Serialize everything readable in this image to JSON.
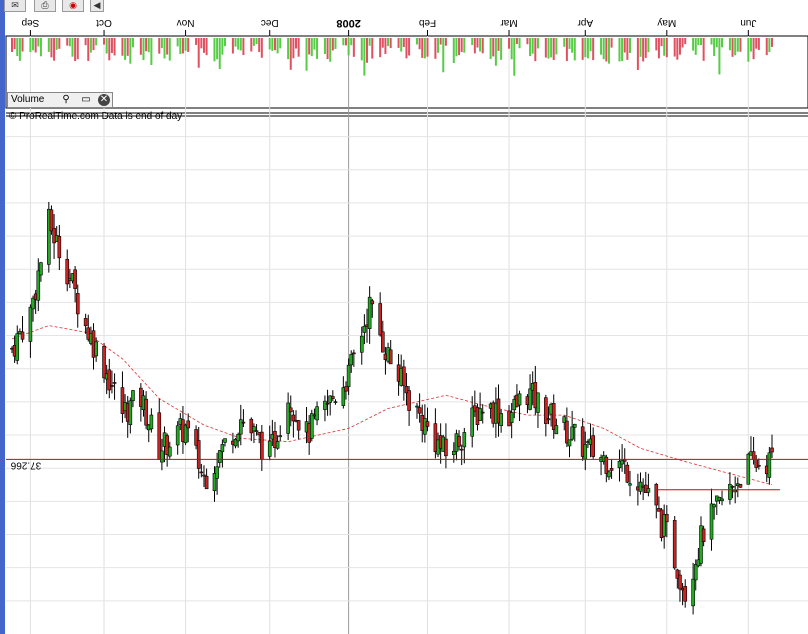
{
  "watermark": "© ProRealTime.com  Data is end of day",
  "volume_panel": {
    "label": "Volume"
  },
  "chart_data": {
    "type": "candlestick",
    "x_axis": {
      "type": "date",
      "range": [
        "2007-08-27",
        "2008-06-11"
      ],
      "tick_labels": [
        "Sep",
        "Oct",
        "Nov",
        "Dec",
        "2008",
        "Feb",
        "Mar",
        "Apr",
        "May",
        "Jun"
      ],
      "tick_dates": [
        "2007-09-03",
        "2007-10-01",
        "2007-11-01",
        "2007-12-03",
        "2008-01-02",
        "2008-02-01",
        "2008-03-03",
        "2008-04-01",
        "2008-05-02",
        "2008-06-02"
      ]
    },
    "y_axis": {
      "range": [
        32.0,
        47.5
      ],
      "tick_labels": []
    },
    "reference_lines": [
      {
        "label": "37.266",
        "value": 37.266,
        "color": "#dd0000"
      },
      {
        "label": "",
        "value": 36.35,
        "color": "#dd0000",
        "start": "2008-04-28",
        "end": "2008-06-14"
      }
    ],
    "colors": {
      "up": "#22aa22",
      "down": "#cc2222",
      "ma": "#dd3333",
      "vol_up": "#55cc44",
      "vol_down": "#e05060"
    },
    "close_series": [
      {
        "date": "2007-08-27",
        "close": 40.6
      },
      {
        "date": "2007-09-03",
        "close": 41.7
      },
      {
        "date": "2007-09-10",
        "close": 44.4
      },
      {
        "date": "2007-09-17",
        "close": 43.0
      },
      {
        "date": "2007-09-24",
        "close": 41.3
      },
      {
        "date": "2007-10-01",
        "close": 40.1
      },
      {
        "date": "2007-10-08",
        "close": 38.7
      },
      {
        "date": "2007-10-15",
        "close": 39.1
      },
      {
        "date": "2007-10-22",
        "close": 37.6
      },
      {
        "date": "2007-11-01",
        "close": 38.2
      },
      {
        "date": "2007-11-08",
        "close": 36.7
      },
      {
        "date": "2007-11-15",
        "close": 37.6
      },
      {
        "date": "2007-11-22",
        "close": 38.5
      },
      {
        "date": "2007-12-03",
        "close": 37.4
      },
      {
        "date": "2007-12-10",
        "close": 39.2
      },
      {
        "date": "2007-12-17",
        "close": 38.0
      },
      {
        "date": "2008-01-02",
        "close": 39.8
      },
      {
        "date": "2008-01-10",
        "close": 41.9
      },
      {
        "date": "2008-01-17",
        "close": 40.4
      },
      {
        "date": "2008-01-25",
        "close": 39.1
      },
      {
        "date": "2008-02-01",
        "close": 38.2
      },
      {
        "date": "2008-02-08",
        "close": 37.4
      },
      {
        "date": "2008-02-15",
        "close": 38.1
      },
      {
        "date": "2008-02-22",
        "close": 38.9
      },
      {
        "date": "2008-03-03",
        "close": 38.6
      },
      {
        "date": "2008-03-10",
        "close": 39.3
      },
      {
        "date": "2008-03-17",
        "close": 38.7
      },
      {
        "date": "2008-04-01",
        "close": 37.6
      },
      {
        "date": "2008-04-08",
        "close": 37.3
      },
      {
        "date": "2008-04-15",
        "close": 37.1
      },
      {
        "date": "2008-04-22",
        "close": 36.6
      },
      {
        "date": "2008-05-02",
        "close": 35.0
      },
      {
        "date": "2008-05-09",
        "close": 33.3
      },
      {
        "date": "2008-05-16",
        "close": 35.1
      },
      {
        "date": "2008-05-23",
        "close": 36.0
      },
      {
        "date": "2008-06-02",
        "close": 37.1
      },
      {
        "date": "2008-06-11",
        "close": 37.2
      }
    ],
    "moving_average": [
      {
        "date": "2007-08-27",
        "value": 40.9
      },
      {
        "date": "2007-09-10",
        "value": 41.3
      },
      {
        "date": "2007-09-24",
        "value": 41.1
      },
      {
        "date": "2007-10-08",
        "value": 40.3
      },
      {
        "date": "2007-10-22",
        "value": 39.1
      },
      {
        "date": "2007-11-08",
        "value": 38.3
      },
      {
        "date": "2007-11-22",
        "value": 37.9
      },
      {
        "date": "2007-12-10",
        "value": 37.8
      },
      {
        "date": "2008-01-02",
        "value": 38.2
      },
      {
        "date": "2008-01-17",
        "value": 38.8
      },
      {
        "date": "2008-02-08",
        "value": 39.2
      },
      {
        "date": "2008-02-22",
        "value": 38.9
      },
      {
        "date": "2008-03-10",
        "value": 38.6
      },
      {
        "date": "2008-03-24",
        "value": 38.6
      },
      {
        "date": "2008-04-08",
        "value": 38.2
      },
      {
        "date": "2008-04-22",
        "value": 37.6
      },
      {
        "date": "2008-05-09",
        "value": 37.2
      },
      {
        "date": "2008-05-23",
        "value": 36.9
      },
      {
        "date": "2008-06-11",
        "value": 36.5
      }
    ]
  }
}
